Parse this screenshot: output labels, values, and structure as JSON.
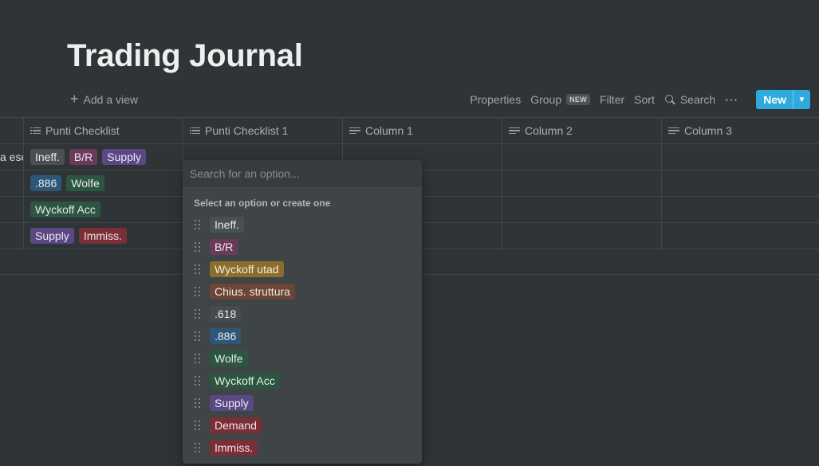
{
  "page": {
    "title": "Trading Journal"
  },
  "views": {
    "add_label": "Add a view"
  },
  "toolbar": {
    "properties": "Properties",
    "group": "Group",
    "group_badge": "NEW",
    "filter": "Filter",
    "sort": "Sort",
    "search": "Search",
    "more": "···",
    "new_label": "New",
    "accent": "#2eaadc"
  },
  "table": {
    "columns": [
      "Punti Checklist",
      "Punti Checklist 1",
      "Column 1",
      "Column 2",
      "Column 3"
    ],
    "column_icons": [
      "list-icon",
      "list-icon",
      "text-icon",
      "text-icon",
      "text-icon"
    ],
    "rows": [
      {
        "first_cell_fragment": "a esc",
        "tags": [
          "Ineff.",
          "B/R",
          "Supply"
        ]
      },
      {
        "first_cell_fragment": "",
        "tags": [
          ".886",
          "Wolfe"
        ]
      },
      {
        "first_cell_fragment": "",
        "tags": [
          "Wyckoff Acc"
        ]
      },
      {
        "first_cell_fragment": "",
        "tags": [
          "Supply",
          "Immiss."
        ]
      }
    ]
  },
  "tag_colors": {
    "Ineff.": "#4a4f53",
    "B/R": "#6b3a5b",
    "Supply": "#5a4885",
    ".886": "#2e5677",
    "Wolfe": "#2d5641",
    "Wyckoff Acc": "#2d5641",
    "Immiss.": "#7a2e35",
    "Wyckoff utad": "#8c6d2b",
    "Chius. struttura": "#6b4535",
    ".618": "#464b4f",
    "Demand": "#7a2e35"
  },
  "dropdown": {
    "search_placeholder": "Search for an option...",
    "hint": "Select an option or create one",
    "options": [
      "Ineff.",
      "B/R",
      "Wyckoff utad",
      "Chius. struttura",
      ".618",
      ".886",
      "Wolfe",
      "Wyckoff Acc",
      "Supply",
      "Demand",
      "Immiss."
    ]
  }
}
